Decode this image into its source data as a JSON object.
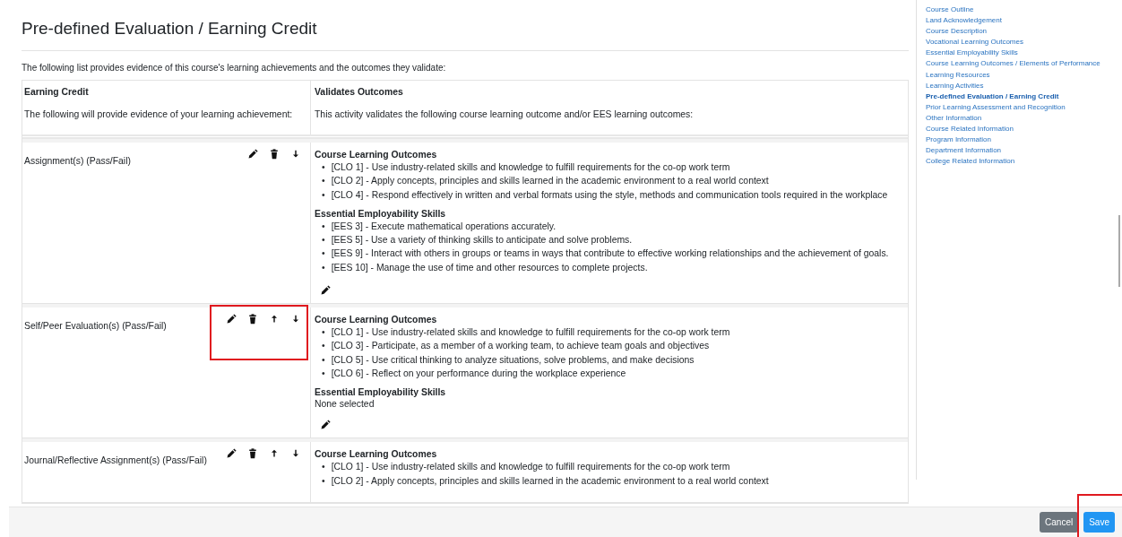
{
  "page": {
    "title": "Pre-defined Evaluation / Earning Credit",
    "intro": "The following list provides evidence of this course's learning achievements and the outcomes they validate:"
  },
  "table": {
    "bullet": "•",
    "columns": [
      {
        "heading": "Earning Credit",
        "note": "The following will provide evidence of your learning achievement:"
      },
      {
        "heading": "Validates Outcomes",
        "note": "This activity validates the following course learning outcome and/or EES learning outcomes:"
      }
    ],
    "rows": [
      {
        "name": "Assignment(s) (Pass/Fail)",
        "actions": [
          {
            "kind": "edit"
          },
          {
            "kind": "delete"
          },
          {
            "kind": "down"
          }
        ],
        "highlighted": false,
        "sections": [
          {
            "heading": "Course Learning Outcomes",
            "items": [
              "[CLO 1] - Use industry-related skills and knowledge to fulfill requirements for the co-op work term",
              "[CLO 2] - Apply concepts, principles and skills learned in the academic environment to a real world context",
              "[CLO 4] - Respond effectively in written and verbal formats using the style, methods and communication tools required in the workplace"
            ]
          },
          {
            "heading": "Essential Employability Skills",
            "items": [
              "[EES 3] - Execute mathematical operations accurately.",
              "[EES 5] - Use a variety of thinking skills to anticipate and solve problems.",
              "[EES 9] - Interact with others in groups or teams in ways that contribute to effective working relationships and the achievement of goals.",
              "[EES 10] - Manage the use of time and other resources to complete projects."
            ]
          }
        ],
        "edit_outcomes": true
      },
      {
        "name": "Self/Peer Evaluation(s) (Pass/Fail)",
        "actions": [
          {
            "kind": "edit"
          },
          {
            "kind": "delete"
          },
          {
            "kind": "up"
          },
          {
            "kind": "down"
          }
        ],
        "highlighted": true,
        "sections": [
          {
            "heading": "Course Learning Outcomes",
            "items": [
              "[CLO 1] - Use industry-related skills and knowledge to fulfill requirements for the co-op work term",
              "[CLO 3] - Participate, as a member of a working team, to achieve team goals and objectives",
              "[CLO 5] - Use critical thinking to analyze situations, solve problems, and make decisions",
              "[CLO 6] - Reflect on your performance during the workplace experience"
            ]
          },
          {
            "heading": "Essential Employability Skills",
            "empty_text": "None selected"
          }
        ],
        "edit_outcomes": true
      },
      {
        "name": "Journal/Reflective Assignment(s) (Pass/Fail)",
        "actions": [
          {
            "kind": "edit"
          },
          {
            "kind": "delete"
          },
          {
            "kind": "up"
          },
          {
            "kind": "down"
          }
        ],
        "highlighted": false,
        "sections": [
          {
            "heading": "Course Learning Outcomes",
            "items": [
              "[CLO 1] - Use industry-related skills and knowledge to fulfill requirements for the co-op work term",
              "[CLO 2] - Apply concepts, principles and skills learned in the academic environment to a real world context"
            ]
          }
        ],
        "edit_outcomes": false
      }
    ]
  },
  "sidebar": {
    "items": [
      {
        "label": "Course Outline",
        "selected": false
      },
      {
        "label": "Land Acknowledgement",
        "selected": false
      },
      {
        "label": "Course Description",
        "selected": false
      },
      {
        "label": "Vocational Learning Outcomes",
        "selected": false
      },
      {
        "label": "Essential Employability Skills",
        "selected": false
      },
      {
        "label": "Course Learning Outcomes / Elements of Performance",
        "selected": false
      },
      {
        "label": "Learning Resources",
        "selected": false
      },
      {
        "label": "Learning Activities",
        "selected": false
      },
      {
        "label": "Pre-defined Evaluation / Earning Credit",
        "selected": true
      },
      {
        "label": "Prior Learning Assessment and Recognition",
        "selected": false
      },
      {
        "label": "Other Information",
        "selected": false
      },
      {
        "label": "Course Related Information",
        "selected": false
      },
      {
        "label": "Program Information",
        "selected": false
      },
      {
        "label": "Department Information",
        "selected": false
      },
      {
        "label": "College Related Information",
        "selected": false
      }
    ]
  },
  "footer": {
    "buttons": [
      {
        "label": "Cancel",
        "kind": "secondary",
        "highlighted": false
      },
      {
        "label": "Save",
        "kind": "primary",
        "highlighted": true
      }
    ]
  }
}
